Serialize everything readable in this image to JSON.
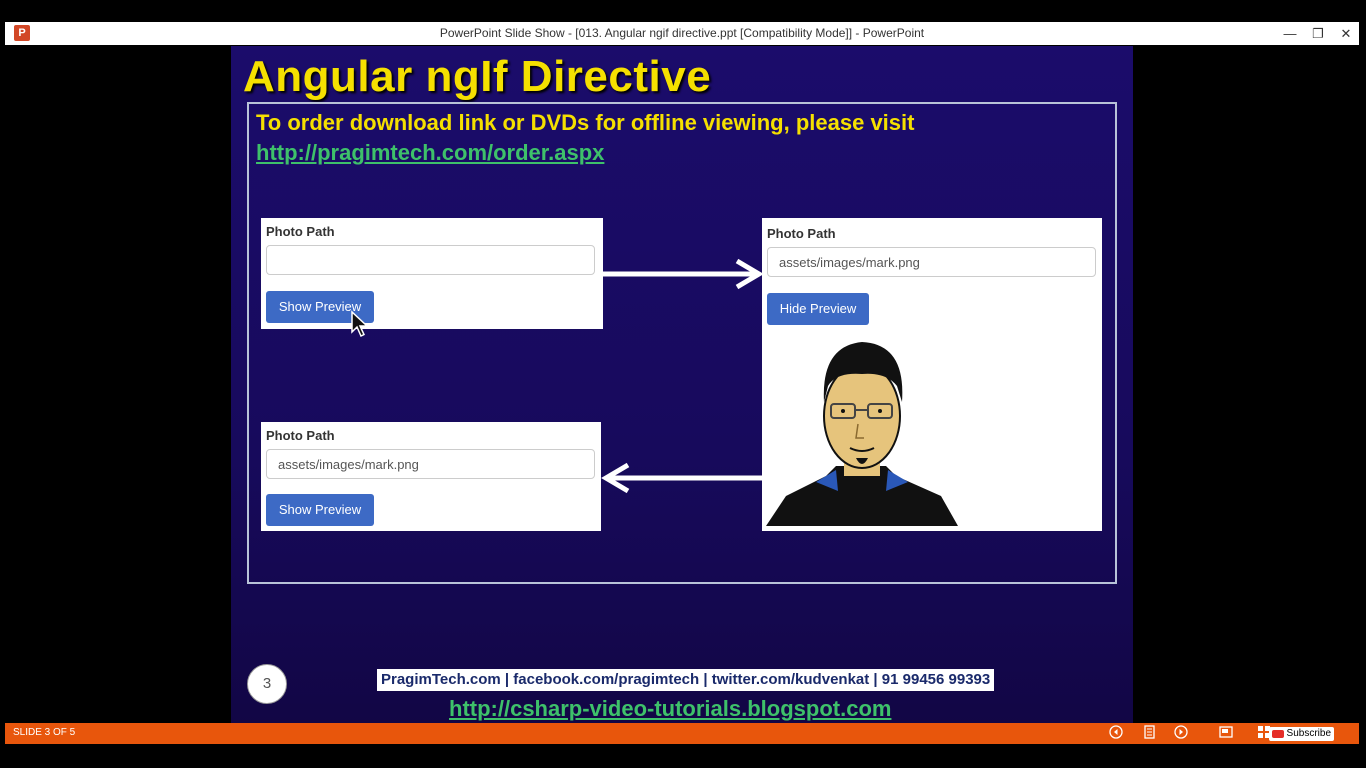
{
  "window": {
    "title": "PowerPoint Slide Show - [013. Angular ngif directive.ppt [Compatibility Mode]] - PowerPoint",
    "app_icon_letter": "P",
    "minimize": "—",
    "restore": "❐",
    "close": "✕"
  },
  "slide": {
    "title": "Angular ngIf Directive",
    "order_text": "To order download link or DVDs for offline viewing, please visit",
    "order_url": "http://pragimtech.com/order.aspx",
    "panel_top_left": {
      "label": "Photo Path",
      "value": "",
      "button": "Show Preview"
    },
    "panel_right": {
      "label": "Photo Path",
      "value": "assets/images/mark.png",
      "button": "Hide Preview"
    },
    "panel_bottom_left": {
      "label": "Photo Path",
      "value": "assets/images/mark.png",
      "button": "Show Preview"
    },
    "page_number": "3",
    "footer_text": "PragimTech.com | facebook.com/pragimtech  | twitter.com/kudvenkat  | 91 99456 99393",
    "footer_url": "http://csharp-video-tutorials.blogspot.com"
  },
  "statusbar": {
    "slide_count": "SLIDE 3 OF 5",
    "subscribe": "Subscribe"
  }
}
